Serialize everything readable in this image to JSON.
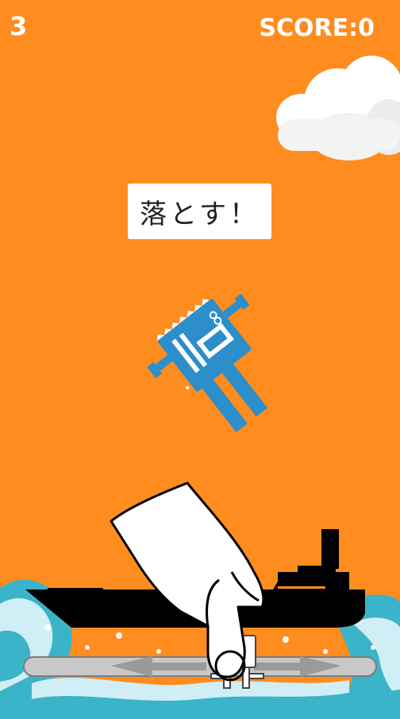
{
  "hud": {
    "lives": "3",
    "score_label": "SCORE:",
    "score_value": "0"
  },
  "prompt": {
    "text": "落とす！"
  },
  "colors": {
    "background": "#ff8c1f",
    "character_blue": "#2c8ecb",
    "ship": "#000000",
    "wave_light": "#cfeef5",
    "wave_teal": "#3bb3c9",
    "slider_track": "#c8c8c8"
  },
  "icons": [
    "cloud-icon",
    "character-sprite",
    "ship-silhouette",
    "wave-decoration",
    "hand-pointer-icon",
    "arrow-left-icon",
    "arrow-right-icon",
    "drop-target-character"
  ]
}
